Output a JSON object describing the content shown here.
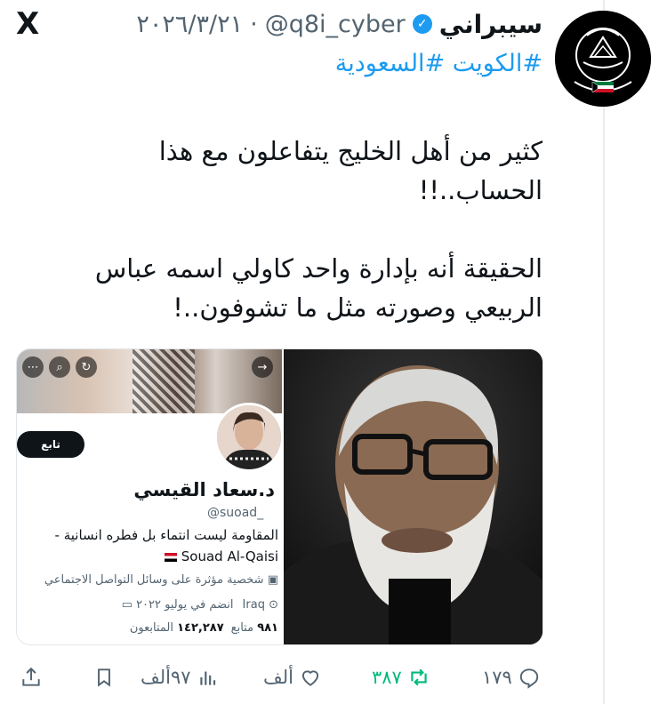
{
  "app": {
    "logo": "X"
  },
  "tweet": {
    "author_name": "سيبراني",
    "handle": "@q8i_cyber",
    "separator": "·",
    "date": "٢٠٢٦/٣/٢١",
    "hashtags": "#الكويت #السعودية",
    "paragraph_1": "كثير من أهل الخليج يتفاعلون مع هذا الحساب..!!",
    "paragraph_2": "الحقيقة أنه بإدارة واحد كاولي اسمه عباس الربيعي وصورته مثل ما تشوفون..!"
  },
  "embedded_profile": {
    "follow_label": "تابع",
    "name": "د.سعاد القيسي",
    "handle": "@suoad_",
    "bio_line_1": "المقاومة ليست انتماء بل فطره انسانية -",
    "bio_line_2": "Souad Al-Qaisi",
    "role": "شخصية مؤثرة على وسائل التواصل الاجتماعي",
    "location": "Iraq",
    "joined": "انضم في يوليو ٢٠٢٢",
    "following_count": "٩٨١",
    "following_label": "متابع",
    "followers_count": "١٤٢,٢٨٧",
    "followers_label": "المتابعون"
  },
  "actions": {
    "replies": "١٧٩",
    "reposts": "٣٨٧",
    "likes": "ألف",
    "views": "٩٧ألف"
  },
  "colors": {
    "accent": "#1d9bf0",
    "repost": "#00ba7c",
    "muted": "#536471"
  }
}
